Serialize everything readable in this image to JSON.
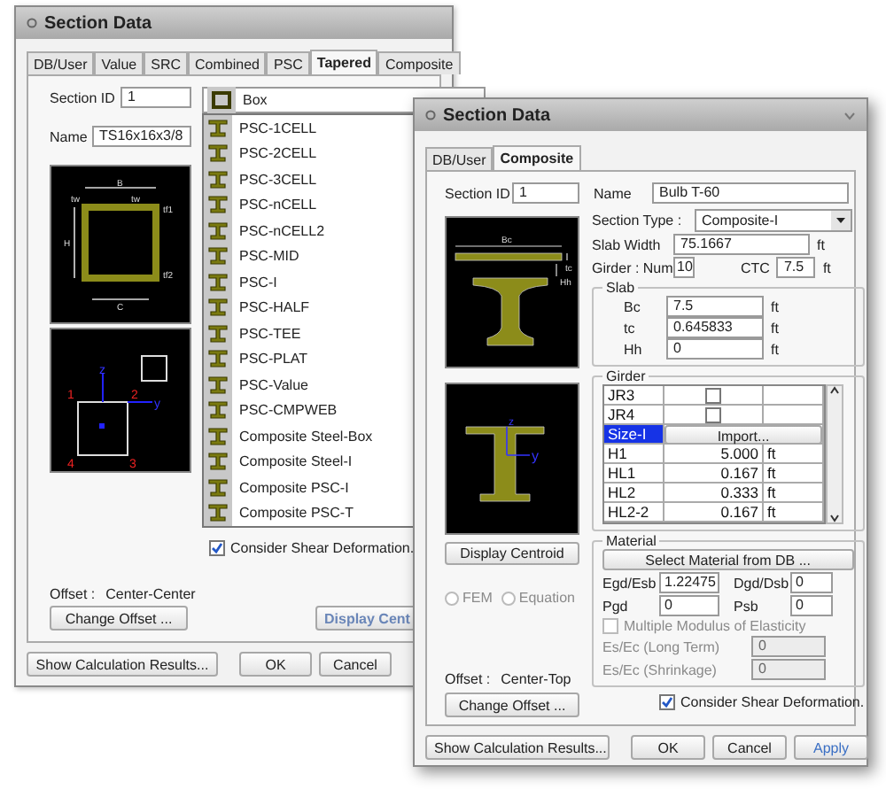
{
  "back_dialog": {
    "title": "Section Data",
    "tabs": [
      {
        "label": "DB/User",
        "selected": false
      },
      {
        "label": "Value",
        "selected": false
      },
      {
        "label": "SRC",
        "selected": false
      },
      {
        "label": "Combined",
        "selected": false
      },
      {
        "label": "PSC",
        "selected": false
      },
      {
        "label": "Tapered",
        "selected": true
      },
      {
        "label": "Composite",
        "selected": false
      }
    ],
    "section_id": {
      "label": "Section ID",
      "value": "1"
    },
    "name": {
      "label": "Name",
      "value": "TS16x16x3/8"
    },
    "section_diagram": {
      "labels": [
        "B",
        "tw",
        "tw",
        "tf1",
        "H",
        "tf2",
        "C"
      ]
    },
    "axis_diagram": {
      "labels": [
        "z",
        "y",
        "1",
        "2",
        "3",
        "4"
      ]
    },
    "shape_dropdown": {
      "value": "Box"
    },
    "shape_list": [
      "PSC-1CELL",
      "PSC-2CELL",
      "PSC-3CELL",
      "PSC-nCELL",
      "PSC-nCELL2",
      "PSC-MID",
      "PSC-I",
      "PSC-HALF",
      "PSC-TEE",
      "PSC-PLAT",
      "PSC-Value",
      "PSC-CMPWEB",
      "Composite Steel-Box",
      "Composite Steel-I",
      "Composite PSC-I",
      "Composite PSC-T"
    ],
    "consider_shear": {
      "label": "Consider Shear Deformation.",
      "checked": true
    },
    "offset": {
      "label": "Offset :",
      "value": "Center-Center"
    },
    "change_offset": "Change Offset ...",
    "display_centroid": "Display Cent",
    "buttons": [
      "Show Calculation Results...",
      "OK",
      "Cancel"
    ]
  },
  "front_dialog": {
    "title": "Section Data",
    "tabs": [
      {
        "label": "DB/User",
        "selected": false
      },
      {
        "label": "Composite",
        "selected": true
      }
    ],
    "section_id": {
      "label": "Section ID",
      "value": "1"
    },
    "name": {
      "label": "Name",
      "value": "Bulb T-60"
    },
    "section_diagram": {
      "labels": [
        "Bc",
        "tc",
        "Hh"
      ]
    },
    "section_type": {
      "label": "Section Type :",
      "value": "Composite-I"
    },
    "slab_width": {
      "label": "Slab Width",
      "value": "75.1667",
      "unit": "ft"
    },
    "girder_num": {
      "label": "Girder : Num",
      "value": "10"
    },
    "ctc": {
      "label": "CTC",
      "value": "7.5",
      "unit": "ft"
    },
    "slab": {
      "title": "Slab",
      "rows": [
        {
          "label": "Bc",
          "value": "7.5",
          "unit": "ft"
        },
        {
          "label": "tc",
          "value": "0.645833",
          "unit": "ft"
        },
        {
          "label": "Hh",
          "value": "0",
          "unit": "ft"
        }
      ]
    },
    "girder": {
      "title": "Girder",
      "rows": [
        {
          "kind": "check",
          "name": "JR3",
          "checked": false
        },
        {
          "kind": "check",
          "name": "JR4",
          "checked": false
        },
        {
          "kind": "button",
          "name": "Size-I",
          "selected": true,
          "button": "Import..."
        },
        {
          "kind": "value",
          "name": "H1",
          "value": "5.000",
          "unit": "ft"
        },
        {
          "kind": "value",
          "name": "HL1",
          "value": "0.167",
          "unit": "ft"
        },
        {
          "kind": "value",
          "name": "HL2",
          "value": "0.333",
          "unit": "ft"
        },
        {
          "kind": "value",
          "name": "HL2-2",
          "value": "0.167",
          "unit": "ft"
        }
      ]
    },
    "centroid_diagram": {
      "labels": [
        "z",
        "y"
      ]
    },
    "display_centroid": "Display Centroid",
    "radios": [
      {
        "label": "FEM",
        "selected": false,
        "disabled": true
      },
      {
        "label": "Equation",
        "selected": false,
        "disabled": true
      }
    ],
    "material": {
      "title": "Material",
      "select_button": "Select Material from DB ...",
      "fields": [
        {
          "label": "Egd/Esb",
          "value": "1.22475"
        },
        {
          "label": "Dgd/Dsb",
          "value": "0"
        },
        {
          "label": "Pgd",
          "value": "0"
        },
        {
          "label": "Psb",
          "value": "0"
        }
      ],
      "multiple_modulus": {
        "label": "Multiple Modulus of Elasticity",
        "checked": false,
        "disabled": true
      },
      "ratios": [
        {
          "label": "Es/Ec (Long Term)",
          "value": "0",
          "disabled": true
        },
        {
          "label": "Es/Ec (Shrinkage)",
          "value": "0",
          "disabled": true
        }
      ]
    },
    "consider_shear": {
      "label": "Consider Shear Deformation.",
      "checked": true
    },
    "offset": {
      "label": "Offset :",
      "value": "Center-Top"
    },
    "change_offset": "Change Offset ...",
    "buttons": [
      {
        "label": "Show Calculation Results...",
        "accent": false
      },
      {
        "label": "OK",
        "accent": false
      },
      {
        "label": "Cancel",
        "accent": false
      },
      {
        "label": "Apply",
        "accent": true
      }
    ]
  }
}
